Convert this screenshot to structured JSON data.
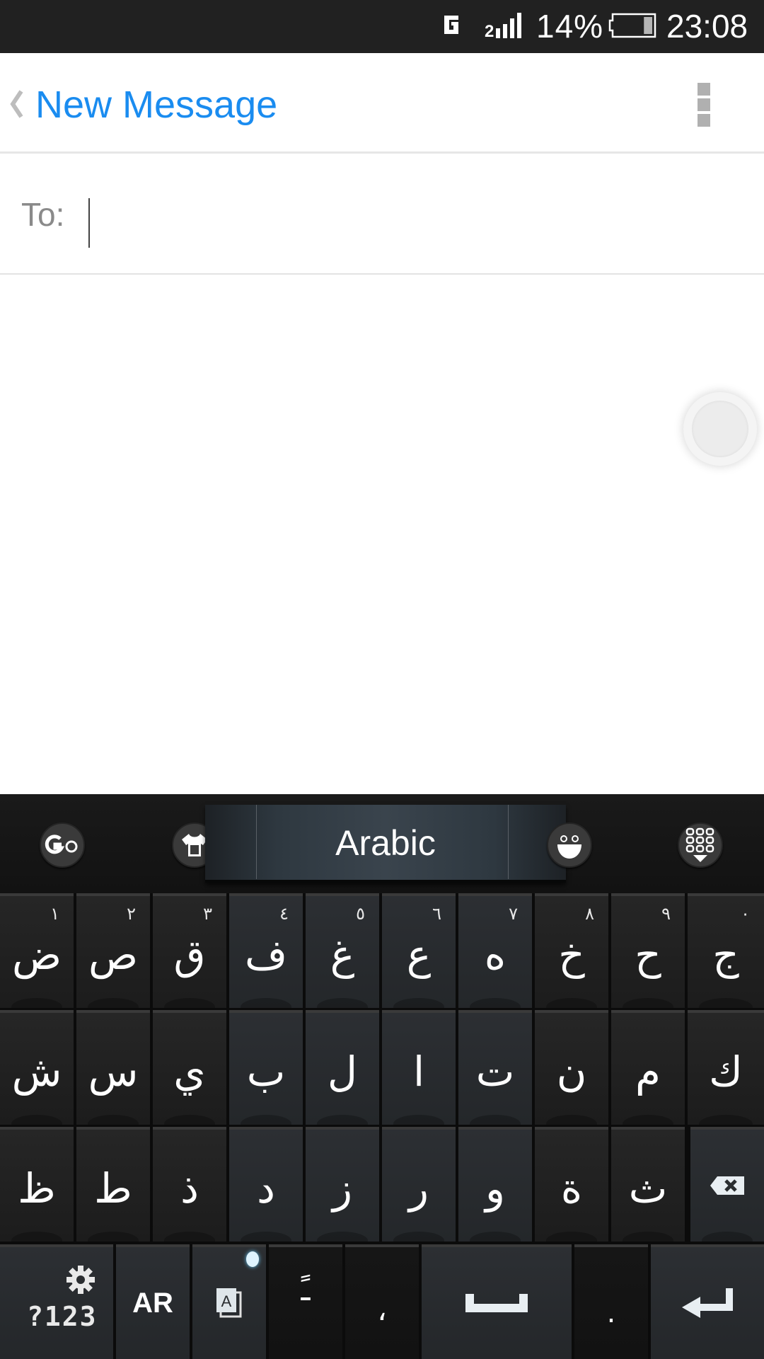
{
  "status_bar": {
    "network_type": "G",
    "signal_sim": "2",
    "battery_percent": "14%",
    "battery_level": 0.14,
    "time": "23:08"
  },
  "header": {
    "back_icon": "chevron-left-icon",
    "title": "New Message",
    "menu_icon": "overflow-menu-icon"
  },
  "compose": {
    "to_label": "To:",
    "to_value": "",
    "to_placeholder": ""
  },
  "floating_button": {
    "icon": "assistive-touch-icon"
  },
  "keyboard": {
    "toolbar": {
      "go_icon": "go-keyboard-logo-icon",
      "theme_icon": "theme-shirt-icon",
      "language_label": "Arabic",
      "emoji_icon": "emoji-smiley-icon",
      "menu_icon": "keyboard-menu-grid-icon"
    },
    "rows": [
      [
        {
          "char": "ض",
          "hint": "١"
        },
        {
          "char": "ص",
          "hint": "٢"
        },
        {
          "char": "ق",
          "hint": "٣"
        },
        {
          "char": "ف",
          "hint": "٤"
        },
        {
          "char": "غ",
          "hint": "٥"
        },
        {
          "char": "ع",
          "hint": "٦"
        },
        {
          "char": "ه",
          "hint": "٧"
        },
        {
          "char": "خ",
          "hint": "٨"
        },
        {
          "char": "ح",
          "hint": "٩"
        },
        {
          "char": "ج",
          "hint": "٠"
        }
      ],
      [
        {
          "char": "ش"
        },
        {
          "char": "س"
        },
        {
          "char": "ي"
        },
        {
          "char": "ب"
        },
        {
          "char": "ل"
        },
        {
          "char": "ا"
        },
        {
          "char": "ت"
        },
        {
          "char": "ن"
        },
        {
          "char": "م"
        },
        {
          "char": "ك"
        }
      ],
      [
        {
          "char": "ظ"
        },
        {
          "char": "ط"
        },
        {
          "char": "ذ"
        },
        {
          "char": "د"
        },
        {
          "char": "ز"
        },
        {
          "char": "ر"
        },
        {
          "char": "و"
        },
        {
          "char": "ة"
        },
        {
          "char": "ث"
        }
      ]
    ],
    "backspace_icon": "backspace-icon",
    "bottom_row": {
      "symbols_label": "?123",
      "settings_icon": "gear-icon",
      "language_key_label": "AR",
      "text_edit_icon": "text-edit-icon",
      "tanween_char": "ً",
      "comma_char": "،",
      "space_icon": "space-bar-icon",
      "period_char": ".",
      "enter_icon": "enter-return-icon"
    }
  }
}
